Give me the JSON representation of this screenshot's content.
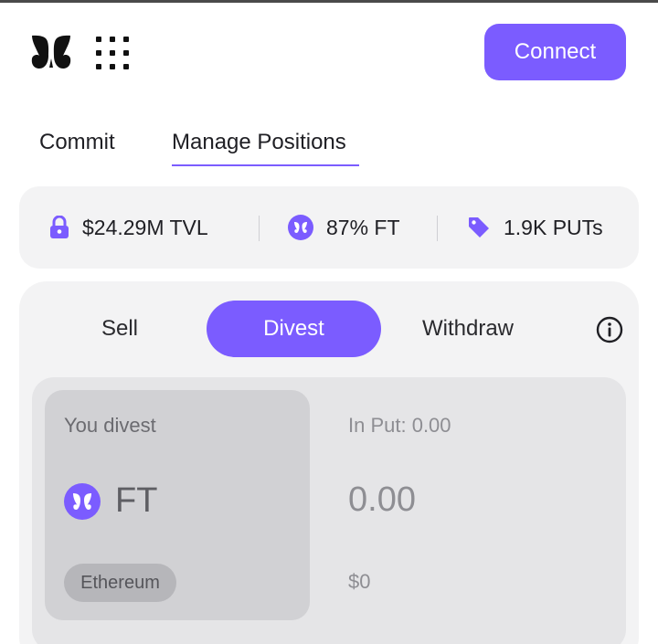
{
  "header": {
    "connect_label": "Connect"
  },
  "nav": {
    "tabs": [
      {
        "label": "Commit",
        "active": false
      },
      {
        "label": "Manage Positions",
        "active": true
      }
    ]
  },
  "stats": {
    "tvl": {
      "icon": "lock-icon",
      "text": "$24.29M TVL"
    },
    "ft": {
      "icon": "ft-token-icon",
      "text": "87% FT"
    },
    "puts": {
      "icon": "tag-icon",
      "text": "1.9K PUTs"
    }
  },
  "actions": {
    "tabs": [
      {
        "label": "Sell",
        "active": false
      },
      {
        "label": "Divest",
        "active": true
      },
      {
        "label": "Withdraw",
        "active": false
      }
    ],
    "info_icon": "info-icon"
  },
  "divest": {
    "input_label": "You divest",
    "token_symbol": "FT",
    "chain": "Ethereum",
    "in_put_label": "In Put: 0.00",
    "amount_value": "0.00",
    "amount_usd": "$0"
  },
  "colors": {
    "accent": "#7b5cff",
    "panel_bg": "#f3f3f4",
    "io_bg": "#e5e5e7",
    "input_card_bg": "#d1d1d4"
  }
}
